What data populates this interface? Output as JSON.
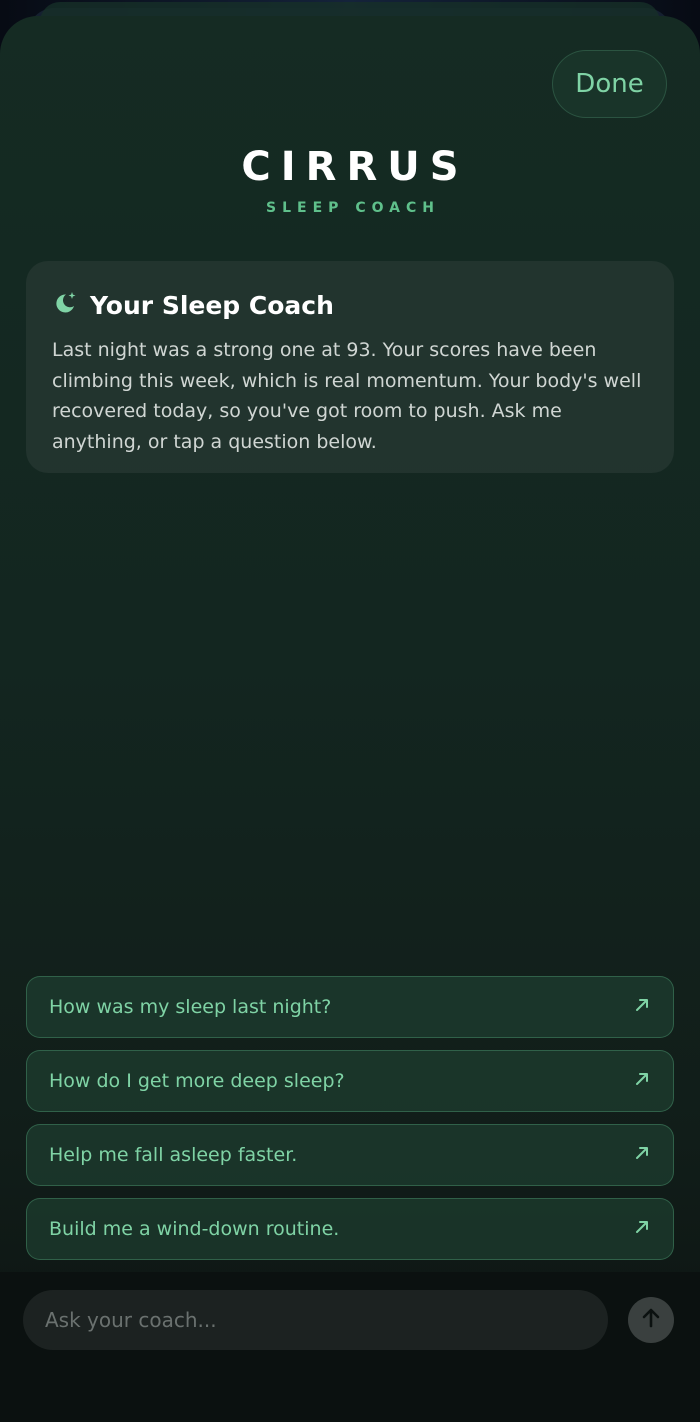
{
  "header": {
    "done_label": "Done",
    "brand_title": "CIRRUS",
    "brand_subtitle": "SLEEP COACH"
  },
  "coach_card": {
    "icon": "moon-sparkle-icon",
    "title": "Your Sleep Coach",
    "message": "Last night was a strong one at 93. Your scores have been climbing this week, which is real momentum. Your body's well recovered today, so you've got room to push. Ask me anything, or tap a question below."
  },
  "suggestions": [
    {
      "label": "How was my sleep last night?",
      "icon": "arrow-up-right-icon"
    },
    {
      "label": "How do I get more deep sleep?",
      "icon": "arrow-up-right-icon"
    },
    {
      "label": "Help me fall asleep faster.",
      "icon": "arrow-up-right-icon"
    },
    {
      "label": "Build me a wind-down routine.",
      "icon": "arrow-up-right-icon"
    }
  ],
  "composer": {
    "placeholder": "Ask your coach...",
    "send_icon": "arrow-up-icon"
  },
  "colors": {
    "accent": "#7fd3a5",
    "brand_sub": "#5fc08b",
    "sheet": "#132620"
  }
}
